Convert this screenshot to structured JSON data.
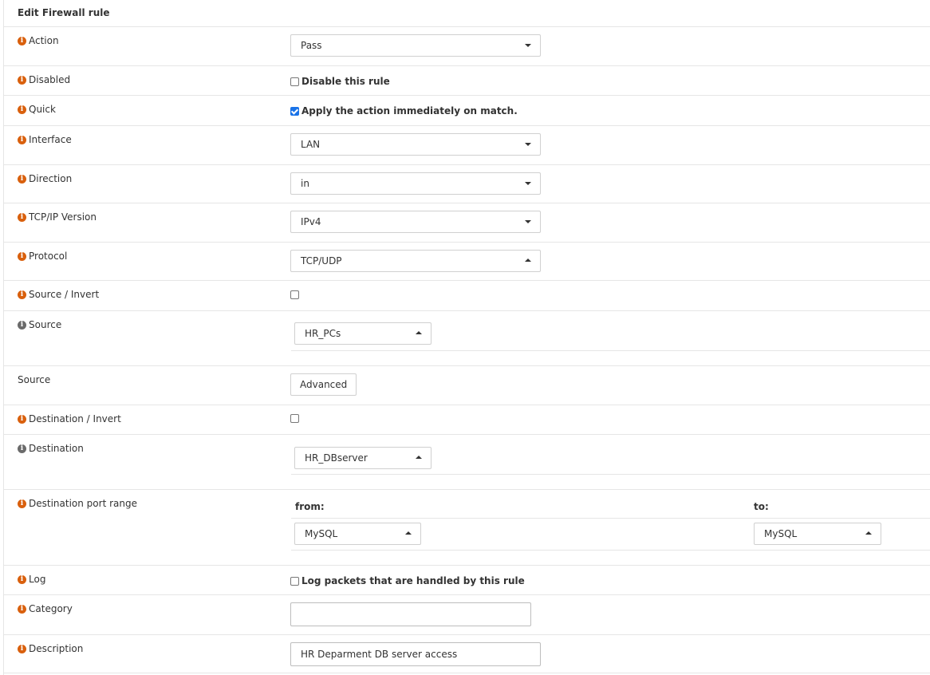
{
  "title": "Edit Firewall rule",
  "action": {
    "label": "Action",
    "value": "Pass"
  },
  "disabled": {
    "label": "Disabled",
    "checkbox_label": "Disable this rule",
    "checked": false
  },
  "quick": {
    "label": "Quick",
    "checkbox_label": "Apply the action immediately on match.",
    "checked": true
  },
  "interface": {
    "label": "Interface",
    "value": "LAN"
  },
  "direction": {
    "label": "Direction",
    "value": "in"
  },
  "tcpip": {
    "label": "TCP/IP Version",
    "value": "IPv4"
  },
  "protocol": {
    "label": "Protocol",
    "value": "TCP/UDP"
  },
  "source_invert": {
    "label": "Source / Invert",
    "checked": false
  },
  "source": {
    "label": "Source",
    "value": "HR_PCs"
  },
  "source_adv": {
    "label": "Source",
    "button": "Advanced"
  },
  "dest_invert": {
    "label": "Destination / Invert",
    "checked": false
  },
  "destination": {
    "label": "Destination",
    "value": "HR_DBserver"
  },
  "dest_port": {
    "label": "Destination port range",
    "from_label": "from:",
    "to_label": "to:",
    "from_value": "MySQL",
    "to_value": "MySQL"
  },
  "log": {
    "label": "Log",
    "checkbox_label": "Log packets that are handled by this rule",
    "checked": false
  },
  "category": {
    "label": "Category",
    "value": ""
  },
  "description": {
    "label": "Description",
    "value": "HR Deparment DB server access"
  },
  "icons": {
    "info": "info-icon"
  },
  "colors": {
    "info_icon": "#d9600d",
    "checkbox_checked": "#1a73e8"
  }
}
